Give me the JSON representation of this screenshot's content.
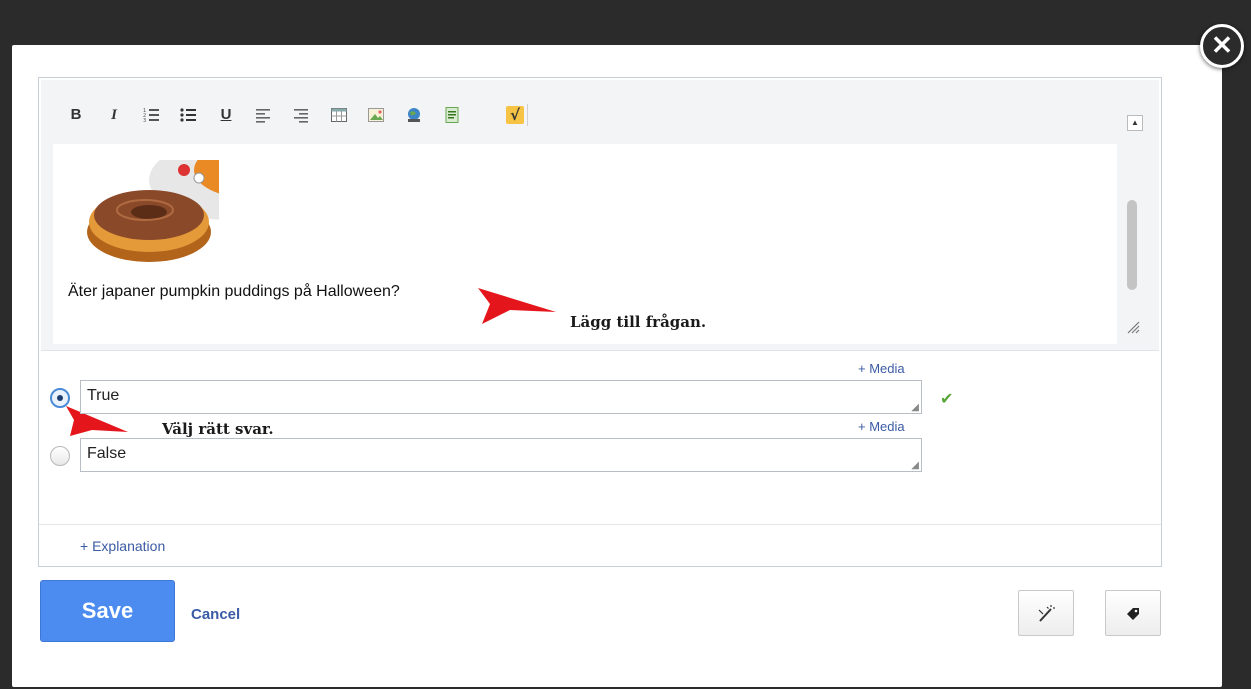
{
  "toolbar": {
    "bold": "B",
    "italic": "I",
    "underline": "U",
    "math": "√"
  },
  "question": {
    "text": "Äter japaner pumpkin puddings på Halloween?"
  },
  "annotations": {
    "add_question": "Lägg till frågan.",
    "choose_answer": "Välj rätt svar."
  },
  "answers": [
    {
      "text": "True",
      "selected": true,
      "media_label": "+ Media"
    },
    {
      "text": "False",
      "selected": false,
      "media_label": "+ Media"
    }
  ],
  "explanation_label": "+ Explanation",
  "footer": {
    "save_label": "Save",
    "cancel_label": "Cancel"
  },
  "colors": {
    "accent": "#4c8cf0",
    "link": "#3b5ba5",
    "annotation_arrow": "#e4161b",
    "check": "#5aa63a"
  },
  "icons": {
    "close": "close-icon",
    "correct": "checkmark-icon",
    "toggle": "magic-wand-icon",
    "tag": "tag-icon"
  }
}
